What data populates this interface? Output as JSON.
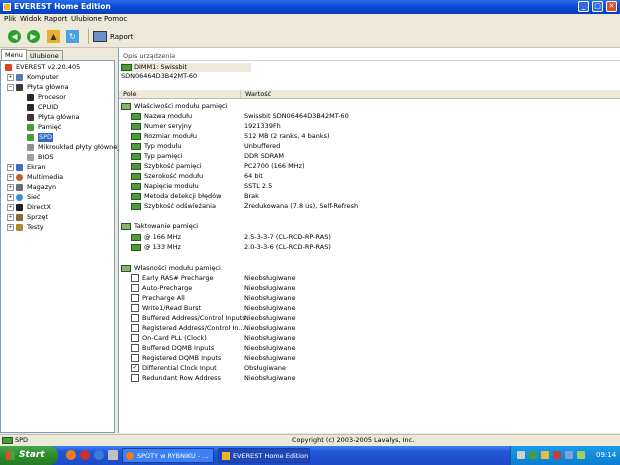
{
  "window": {
    "title": "EVEREST Home Edition"
  },
  "menu": [
    "Plik",
    "Widok",
    "Raport",
    "Ulubione",
    "Pomoc"
  ],
  "toolbar": {
    "report_label": "Raport"
  },
  "tabs": [
    "Menu",
    "Ulubione"
  ],
  "tree": [
    {
      "label": "EVEREST v2.20.405"
    },
    {
      "label": "Komputer"
    },
    {
      "label": "Płyta główna"
    },
    {
      "label": "Procesor"
    },
    {
      "label": "CPUID"
    },
    {
      "label": "Płyta główna"
    },
    {
      "label": "Pamięć"
    },
    {
      "label": "SPD"
    },
    {
      "label": "Mikroukład płyty głównej"
    },
    {
      "label": "BIOS"
    },
    {
      "label": "Ekran"
    },
    {
      "label": "Multimedia"
    },
    {
      "label": "Magazyn"
    },
    {
      "label": "Sieć"
    },
    {
      "label": "DirectX"
    },
    {
      "label": "Sprzęt"
    },
    {
      "label": "Testy"
    }
  ],
  "description": {
    "header": "Opis urządzenia",
    "value": "DIMM1: Swissbit SDN06464D3B42MT-60"
  },
  "columns": {
    "field": "Pole",
    "value": "Wartość"
  },
  "sections": {
    "module_props": "Właściwości modułu pamięci",
    "timings": "Taktowanie pamięci",
    "features": "Własności modułu pamięci"
  },
  "module_props": [
    {
      "field": "Nazwa modułu",
      "value": "Swissbit SDN06464D3B42MT-60"
    },
    {
      "field": "Numer seryjny",
      "value": "1921339Fh"
    },
    {
      "field": "Rozmiar modułu",
      "value": "512 MB (2 ranks, 4 banks)"
    },
    {
      "field": "Typ modułu",
      "value": "Unbuffered"
    },
    {
      "field": "Typ pamięci",
      "value": "DDR SDRAM"
    },
    {
      "field": "Szybkość pamięci",
      "value": "PC2700 (166 MHz)"
    },
    {
      "field": "Szerokość modułu",
      "value": "64 bit"
    },
    {
      "field": "Napięcie modułu",
      "value": "SSTL 2.5"
    },
    {
      "field": "Metoda detekcji błędów",
      "value": "Brak"
    },
    {
      "field": "Szybkość odświeżania",
      "value": "Zredukowana (7.8 us), Self-Refresh"
    }
  ],
  "timings": [
    {
      "field": "@ 166 MHz",
      "value": "2.5-3-3-7  (CL-RCD-RP-RAS)"
    },
    {
      "field": "@ 133 MHz",
      "value": "2.0-3-3-6  (CL-RCD-RP-RAS)"
    }
  ],
  "features": [
    {
      "field": "Early RAS# Precharge",
      "value": "Nieobsługiwane",
      "checked": false
    },
    {
      "field": "Auto-Precharge",
      "value": "Nieobsługiwane",
      "checked": false
    },
    {
      "field": "Precharge All",
      "value": "Nieobsługiwane",
      "checked": false
    },
    {
      "field": "Write1/Read Burst",
      "value": "Nieobsługiwane",
      "checked": false
    },
    {
      "field": "Buffered Address/Control Inputs",
      "value": "Nieobsługiwane",
      "checked": false
    },
    {
      "field": "Registered Address/Control In...",
      "value": "Nieobsługiwane",
      "checked": false
    },
    {
      "field": "On-Card PLL (Clock)",
      "value": "Nieobsługiwane",
      "checked": false
    },
    {
      "field": "Buffered DQMB Inputs",
      "value": "Nieobsługiwane",
      "checked": false
    },
    {
      "field": "Registered DQMB Inputs",
      "value": "Nieobsługiwane",
      "checked": false
    },
    {
      "field": "Differential Clock Input",
      "value": "Obsługiwane",
      "checked": true
    },
    {
      "field": "Redundant Row Address",
      "value": "Nieobsługiwane",
      "checked": false
    }
  ],
  "status": {
    "left": "SPD",
    "center": "Copyright (c) 2003-2005 Lavalys, Inc."
  },
  "taskbar": {
    "start": "Start",
    "items": [
      "SPOTY w RYBNIKU - ...",
      "EVEREST Home Edition"
    ],
    "clock": "09:14"
  },
  "colors": {
    "title_blue": "#0a4cd6",
    "selection": "#316ac5",
    "taskbar": "#2456d8",
    "start_green": "#2e8b2e"
  }
}
